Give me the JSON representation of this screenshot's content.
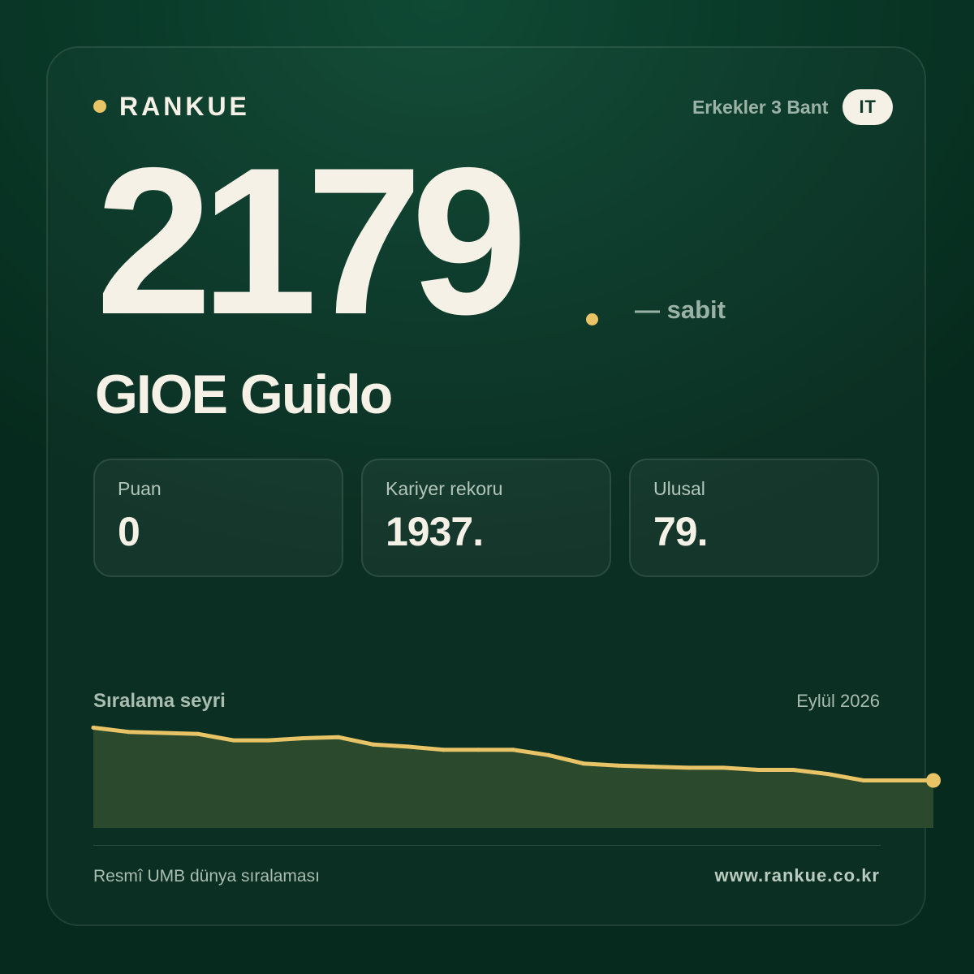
{
  "brand": {
    "name": "RANKUE",
    "accent_color": "#e9c466"
  },
  "category": {
    "label": "Erkekler 3 Bant",
    "country": "IT"
  },
  "rank": {
    "value": "2179",
    "change": "— sabit"
  },
  "player": {
    "name": "GIOE Guido"
  },
  "stats": [
    {
      "label": "Puan",
      "value": "0"
    },
    {
      "label": "Kariyer rekoru",
      "value": "1937."
    },
    {
      "label": "Ulusal",
      "value": "79."
    }
  ],
  "trend": {
    "title": "Sıralama seyri",
    "date": "Eylül 2026"
  },
  "chart_data": {
    "type": "area",
    "title": "Sıralama seyri",
    "xlabel": "",
    "ylabel": "",
    "line_color": "#e9c466",
    "fill_color": "#2b4a2d",
    "grid": false,
    "legend": "none",
    "ylim": [
      0,
      1
    ],
    "values": [
      0.95,
      0.91,
      0.9,
      0.89,
      0.83,
      0.83,
      0.85,
      0.86,
      0.79,
      0.77,
      0.74,
      0.74,
      0.74,
      0.69,
      0.61,
      0.59,
      0.58,
      0.57,
      0.57,
      0.55,
      0.55,
      0.51,
      0.45,
      0.45,
      0.45
    ]
  },
  "footer": {
    "source": "Resmî UMB dünya sıralaması",
    "url": "www.rankue.co.kr"
  }
}
